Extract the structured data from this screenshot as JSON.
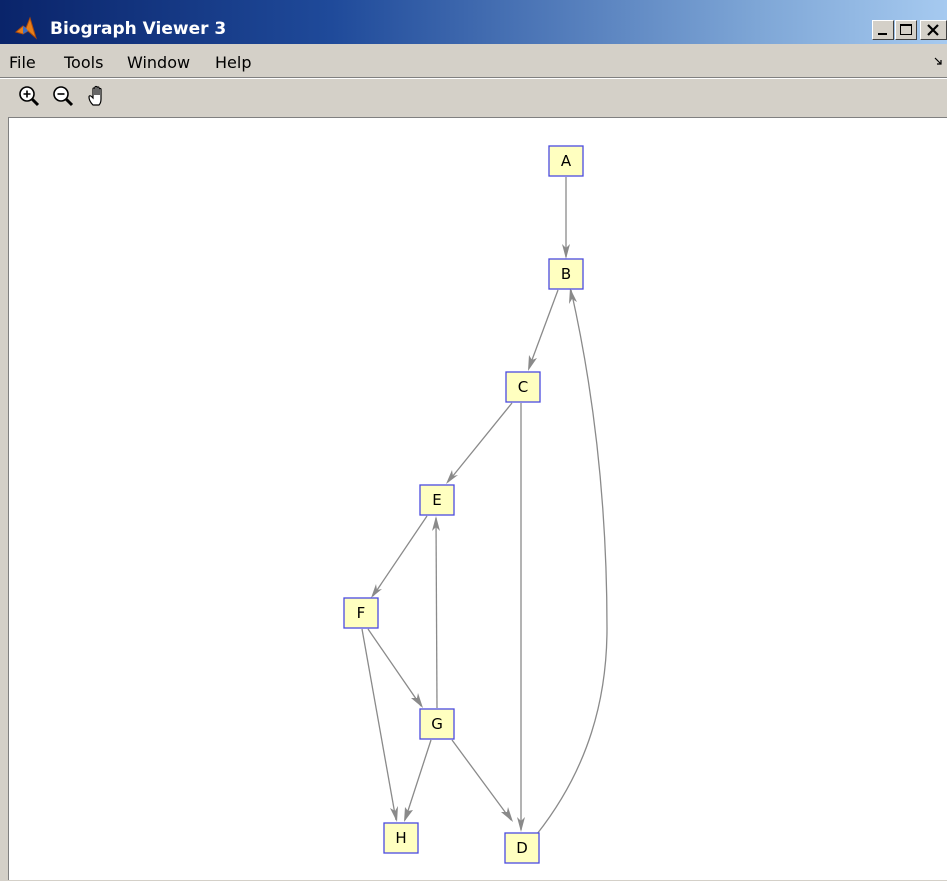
{
  "window": {
    "title": "Biograph Viewer 3",
    "controls": [
      "minimize",
      "maximize",
      "close"
    ]
  },
  "menu": {
    "items": [
      "File",
      "Tools",
      "Window",
      "Help"
    ]
  },
  "toolbar": {
    "tools": [
      {
        "name": "zoom-in",
        "icon": "magnifier-plus-icon"
      },
      {
        "name": "zoom-out",
        "icon": "magnifier-minus-icon"
      },
      {
        "name": "pan",
        "icon": "hand-icon"
      }
    ]
  },
  "colors": {
    "node_fill": "#ffffc0",
    "node_border": "#4a4ae0",
    "edge": "#8a8a8a",
    "titlebar_start": "#0a246a",
    "titlebar_end": "#a6caf0"
  },
  "graph": {
    "nodes": [
      "A",
      "B",
      "C",
      "D",
      "E",
      "F",
      "G",
      "H"
    ],
    "edges": [
      [
        "A",
        "B"
      ],
      [
        "B",
        "C"
      ],
      [
        "C",
        "E"
      ],
      [
        "C",
        "D"
      ],
      [
        "E",
        "F"
      ],
      [
        "F",
        "G"
      ],
      [
        "F",
        "H"
      ],
      [
        "G",
        "E"
      ],
      [
        "G",
        "H"
      ],
      [
        "G",
        "D"
      ],
      [
        "D",
        "B"
      ]
    ]
  }
}
